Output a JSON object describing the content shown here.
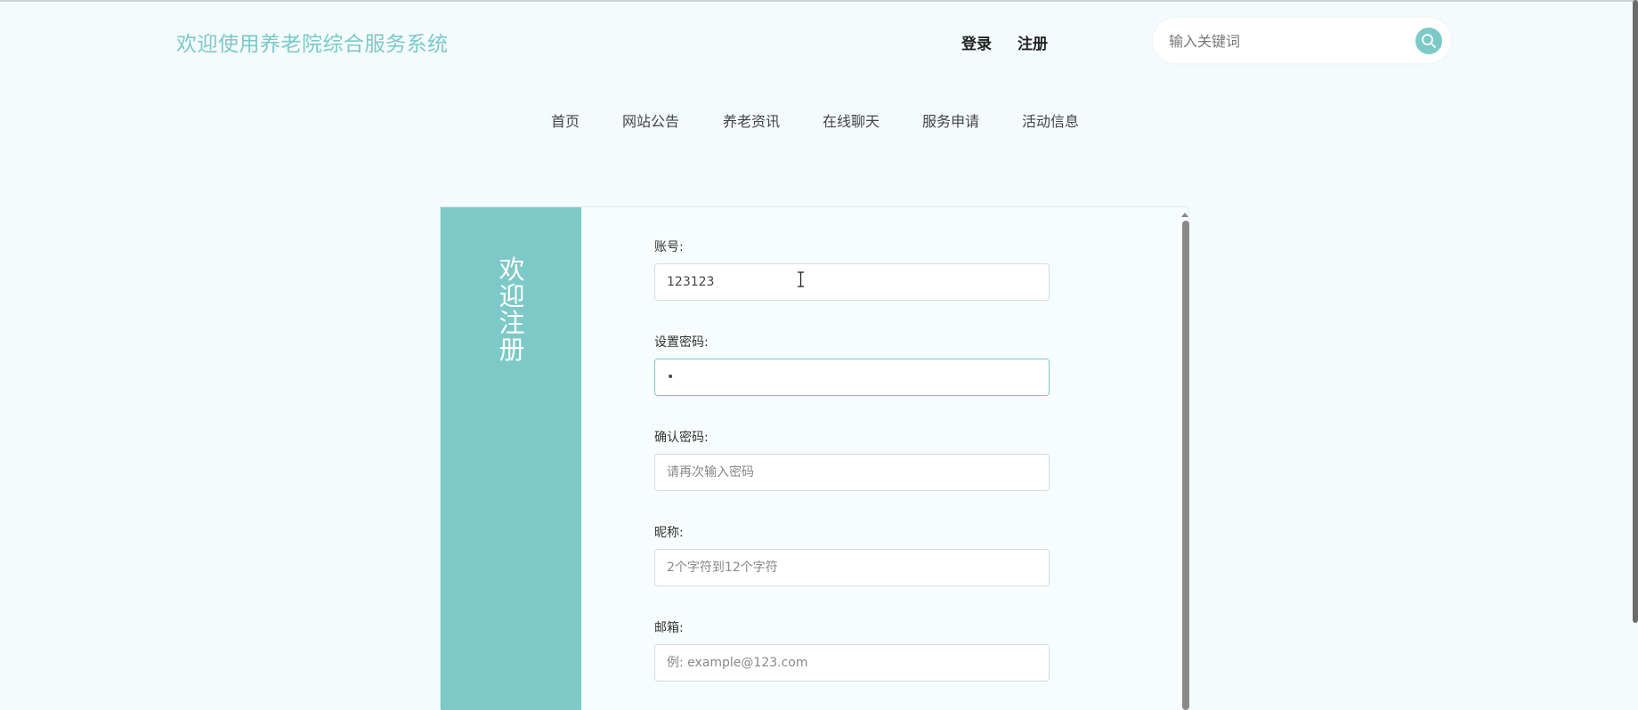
{
  "header": {
    "site_title": "欢迎使用养老院综合服务系统",
    "login_label": "登录",
    "register_label": "注册",
    "search_placeholder": "输入关键词"
  },
  "nav": {
    "items": [
      {
        "label": "首页"
      },
      {
        "label": "网站公告"
      },
      {
        "label": "养老资讯"
      },
      {
        "label": "在线聊天"
      },
      {
        "label": "服务申请"
      },
      {
        "label": "活动信息"
      }
    ]
  },
  "register_form": {
    "banner_title": "欢迎注册",
    "account": {
      "label": "账号:",
      "value": "123123",
      "placeholder": ""
    },
    "password": {
      "label": "设置密码:",
      "value": "•",
      "placeholder": ""
    },
    "confirm_password": {
      "label": "确认密码:",
      "value": "",
      "placeholder": "请再次输入密码"
    },
    "nickname": {
      "label": "昵称:",
      "value": "",
      "placeholder": "2个字符到12个字符"
    },
    "email": {
      "label": "邮箱:",
      "value": "",
      "placeholder": "例: example@123.com"
    }
  },
  "colors": {
    "accent": "#7cc9c8",
    "page_background": "#f4fbfd"
  },
  "icons": {
    "search": "search-icon"
  }
}
